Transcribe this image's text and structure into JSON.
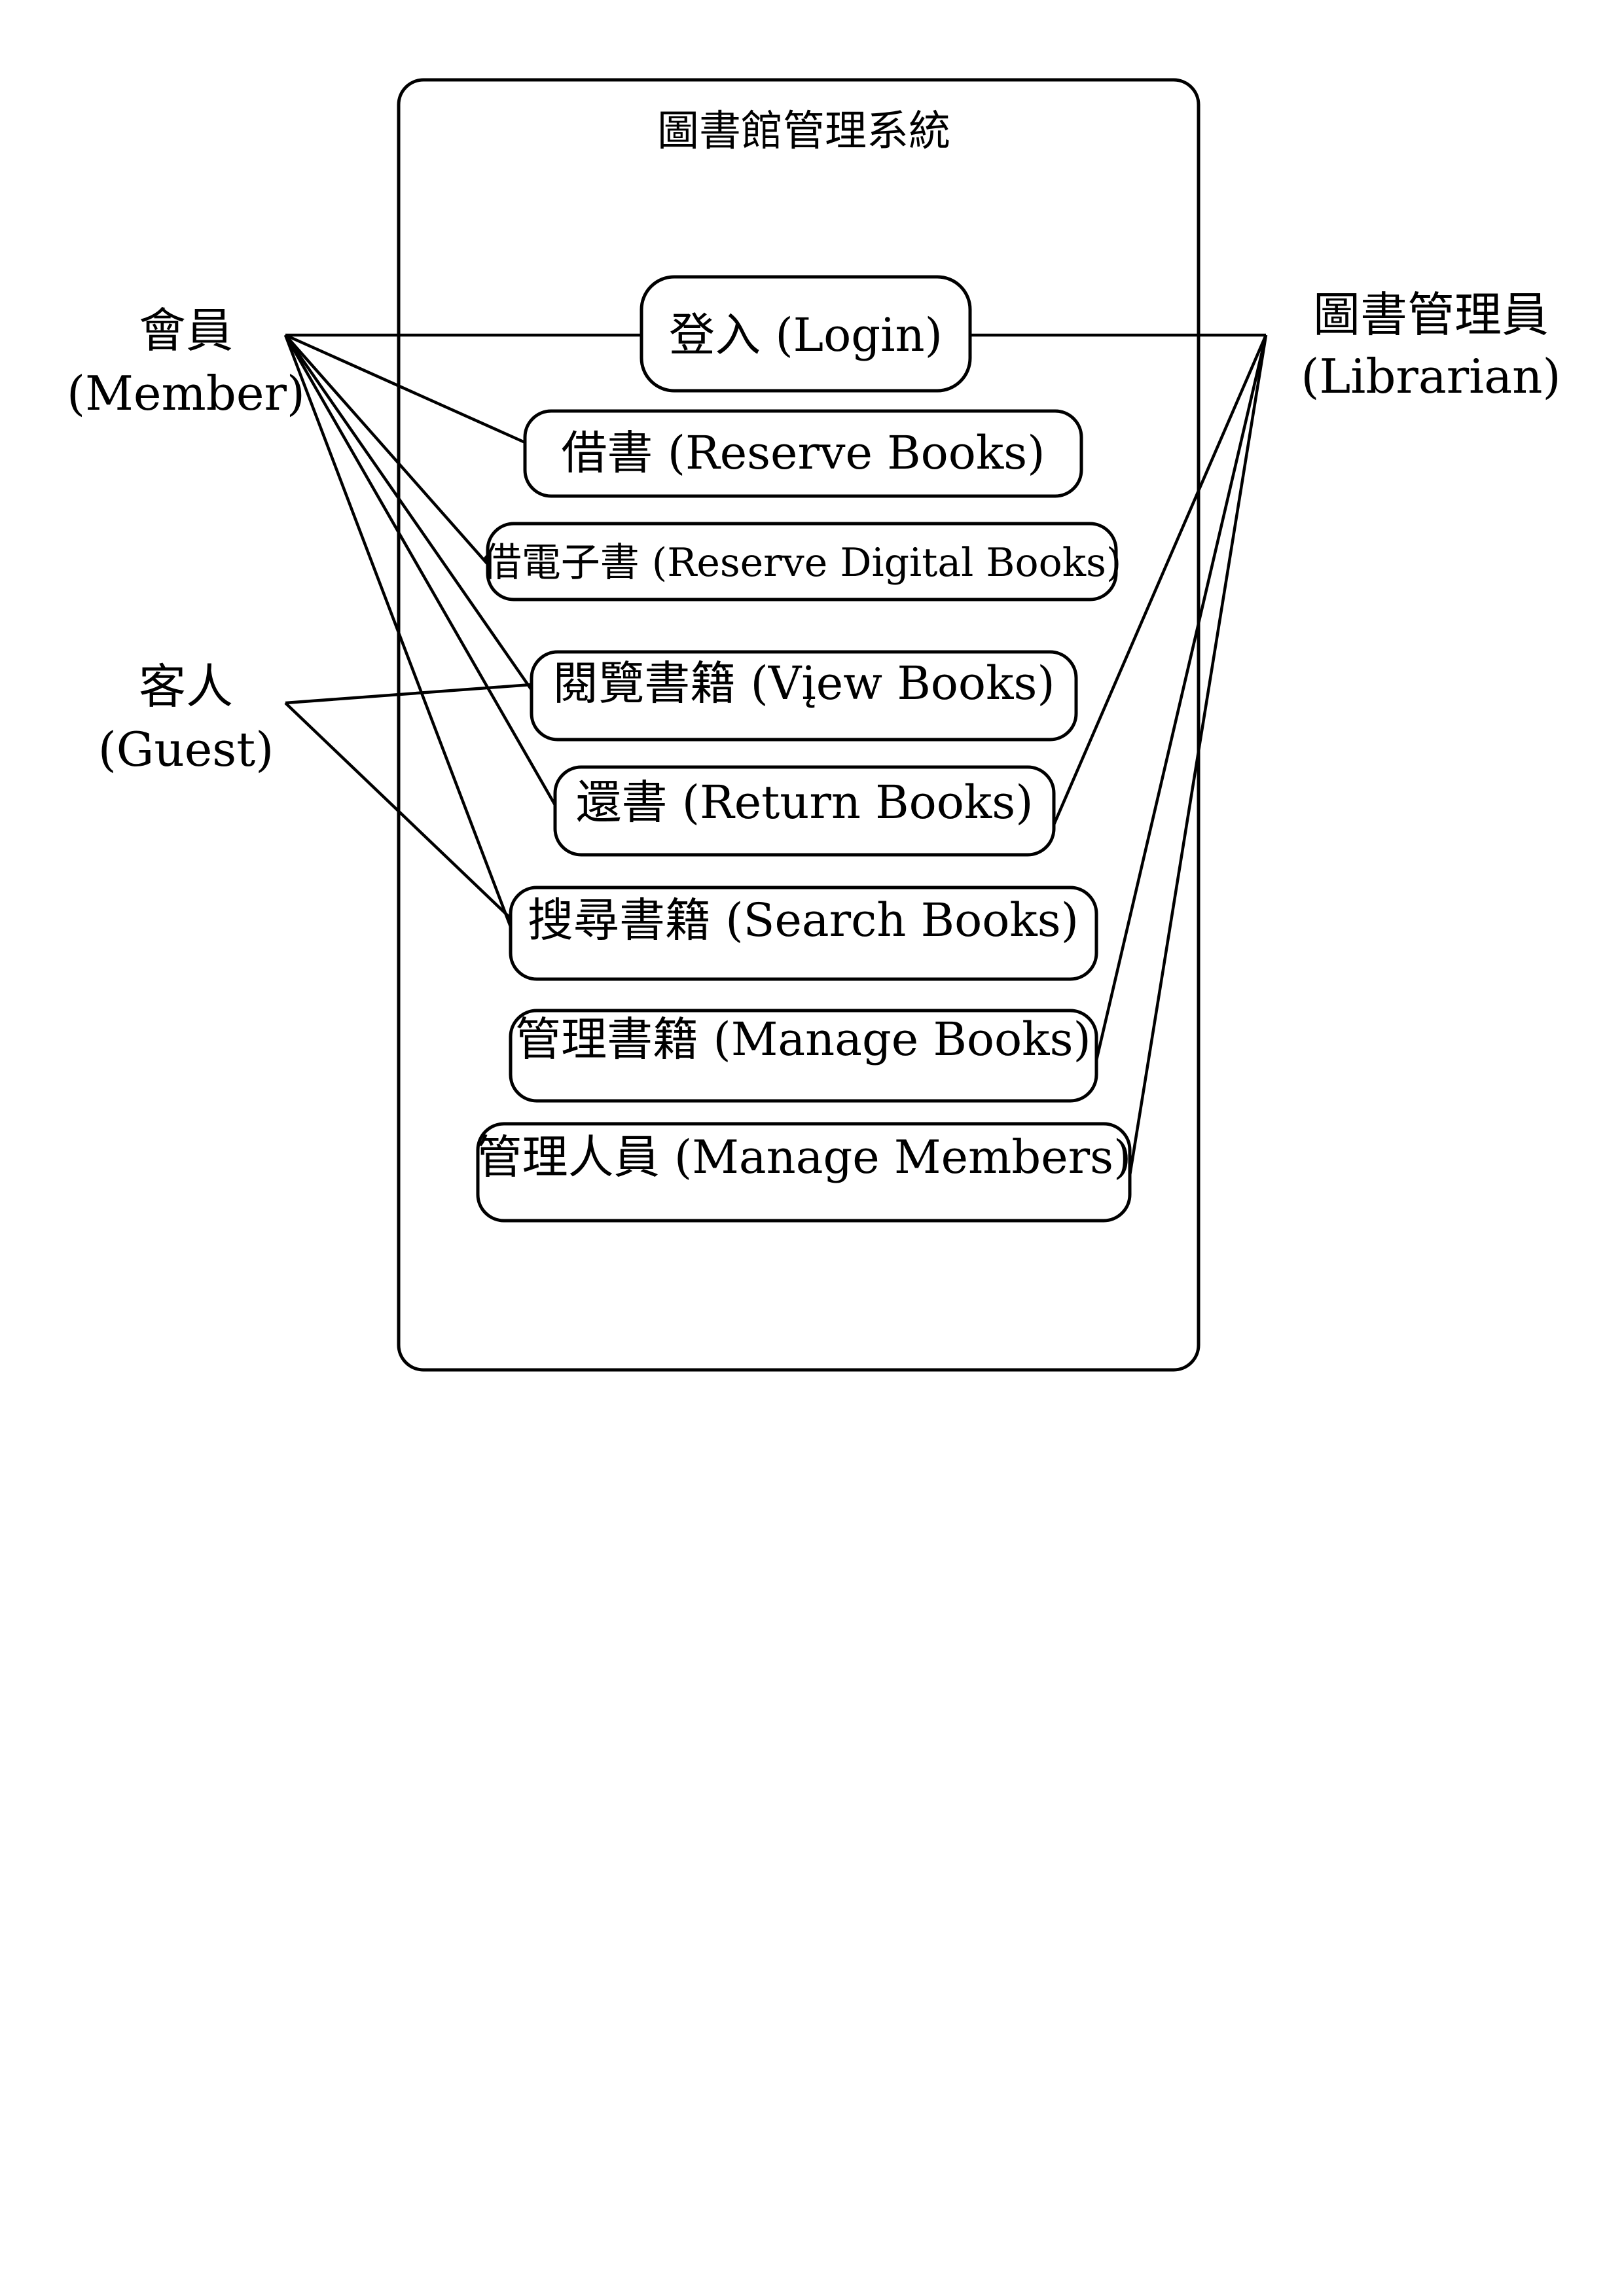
{
  "system": {
    "title": "圖書館管理系統"
  },
  "actors": {
    "member": {
      "name": "會員",
      "english": "(Member)"
    },
    "guest": {
      "name": "客人",
      "english": "(Guest)"
    },
    "librarian": {
      "name": "圖書管理員",
      "english": "(Librarian)"
    }
  },
  "use_cases": {
    "login": "登入 (Login)",
    "reserve_books": "借書 (Reserve Books)",
    "reserve_digital_books": "借電子書 (Reserve Digital Books)",
    "view_books": "閱覽書籍 (Vįew Books)",
    "return_books": "還書 (Return Books)",
    "search_books": "搜尋書籍 (Search Books)",
    "manage_books": "管理書籍 (Manage Books)",
    "manage_members": "管理人員 (Manage Members)"
  },
  "associations": [
    {
      "actor": "會員",
      "use_case": "登入 (Login)"
    },
    {
      "actor": "會員",
      "use_case": "借書 (Reserve Books)"
    },
    {
      "actor": "會員",
      "use_case": "借電子書 (Reserve Digital Books)"
    },
    {
      "actor": "會員",
      "use_case": "閱覽書籍 (Vįew Books)"
    },
    {
      "actor": "會員",
      "use_case": "還書 (Return Books)"
    },
    {
      "actor": "會員",
      "use_case": "搜尋書籍 (Search Books)"
    },
    {
      "actor": "客人",
      "use_case": "閱覽書籍 (Vįew Books)"
    },
    {
      "actor": "客人",
      "use_case": "搜尋書籍 (Search Books)"
    },
    {
      "actor": "圖書管理員",
      "use_case": "登入 (Login)"
    },
    {
      "actor": "圖書管理員",
      "use_case": "還書 (Return Books)"
    },
    {
      "actor": "圖書管理員",
      "use_case": "管理書籍 (Manage Books)"
    },
    {
      "actor": "圖書管理員",
      "use_case": "管理人員 (Manage Members)"
    }
  ]
}
